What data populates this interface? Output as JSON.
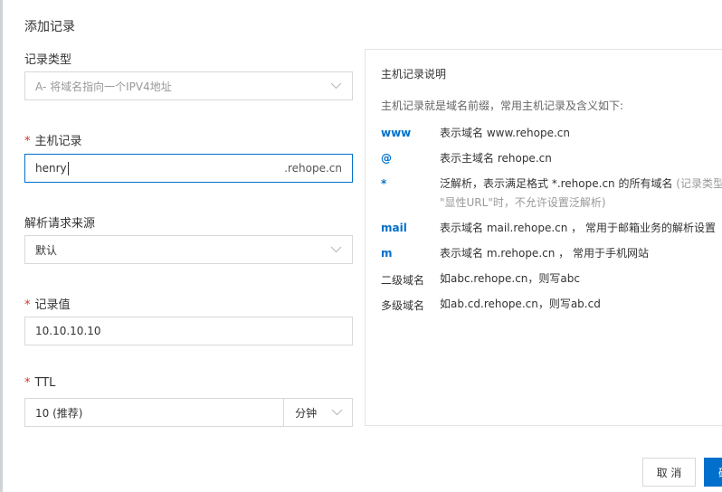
{
  "dialog": {
    "title": "添加记录"
  },
  "form": {
    "record_type": {
      "label": "记录类型",
      "placeholder": "A- 将域名指向一个IPV4地址"
    },
    "host_record": {
      "required_mark": "*",
      "label": "主机记录",
      "value": "henry",
      "suffix": ".rehope.cn"
    },
    "resolve_source": {
      "label": "解析请求来源",
      "value": "默认"
    },
    "record_value": {
      "required_mark": "*",
      "label": "记录值",
      "value": "10.10.10.10"
    },
    "ttl": {
      "required_mark": "*",
      "label": "TTL",
      "value": "10 (推荐)",
      "unit": "分钟"
    }
  },
  "help": {
    "title": "主机记录说明",
    "description": "主机记录就是域名前缀，常用主机记录及含义如下:",
    "rows": [
      {
        "key": "www",
        "text": "表示域名 www.rehope.cn"
      },
      {
        "key": "@",
        "text": "表示主域名 rehope.cn"
      },
      {
        "key": "*",
        "text": "泛解析，表示满足格式 *.rehope.cn 的所有域名",
        "note": "(记录类型为",
        "line2": "\"显性URL\"时，不允许设置泛解析)"
      },
      {
        "key": "mail",
        "text": "表示域名 mail.rehope.cn ， 常用于邮箱业务的解析设置"
      },
      {
        "key": "m",
        "text": "表示域名 m.rehope.cn ， 常用于手机网站"
      },
      {
        "key": "二级域名",
        "text": "如abc.rehope.cn，则写abc"
      },
      {
        "key": "多级域名",
        "text": "如ab.cd.rehope.cn，则写ab.cd"
      }
    ]
  },
  "buttons": {
    "cancel": "取 消",
    "ok": "确"
  },
  "colors": {
    "accent": "#0070cc",
    "required": "#d93026",
    "border": "#d7d8d9"
  }
}
